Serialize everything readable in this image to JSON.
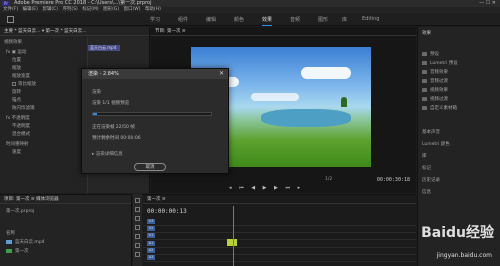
{
  "titlebar": {
    "app_badge": "Pr",
    "title": "Adobe Premiere Pro CC 2018 - C:\\Users\\...\\第一次.prproj",
    "controls": "—  ☐  ✕"
  },
  "menubar": [
    "文件(F)",
    "编辑(E)",
    "剪辑(C)",
    "序列(S)",
    "标记(M)",
    "图形(G)",
    "窗口(W)",
    "帮助(H)"
  ],
  "workspaces": [
    "学习",
    "组件",
    "编辑",
    "颜色",
    "效果",
    "音频",
    "图形",
    "库",
    "Editing"
  ],
  "active_workspace": "效果",
  "effect_controls": {
    "header": "主要 * 蓝天白云... ▾ 第一次 * 蓝天白云...",
    "clip_name": "蓝天白云.mp4",
    "rows": [
      {
        "label": "视频效果",
        "value": ""
      },
      {
        "label": "fx ▣ 运动",
        "value": ""
      },
      {
        "label": "位置",
        "value": ""
      },
      {
        "label": "缩放",
        "value": ""
      },
      {
        "label": "缩放宽度",
        "value": ""
      },
      {
        "label": "等比缩放",
        "value": ""
      },
      {
        "label": "旋转",
        "value": ""
      },
      {
        "label": "锚点",
        "value": ""
      },
      {
        "label": "防闪烁滤镜",
        "value": ""
      },
      {
        "label": "fx 不透明度",
        "value": ""
      },
      {
        "label": "不透明度",
        "value": ""
      },
      {
        "label": "混合模式",
        "value": ""
      },
      {
        "label": "时间重映射",
        "value": ""
      },
      {
        "label": "速度",
        "value": ""
      }
    ]
  },
  "monitor": {
    "header": "节目: 第一次 ≡",
    "timecode": "00:00:30:18",
    "zoom": "1/2",
    "controls": "◂ ⏮ ◀ ▶ ▶ ⏭ ▸"
  },
  "right_panel": {
    "title": "效果",
    "items": [
      "预设",
      "Lumetri 预设",
      "音频效果",
      "音频过渡",
      "视频效果",
      "视频过渡",
      "自定义素材箱"
    ],
    "lower": [
      "基本声音",
      "Lumetri 颜色",
      "库",
      "标记",
      "历史记录",
      "信息"
    ]
  },
  "project": {
    "header": "项目: 第一次 ≡  媒体浏览器",
    "file": "第一次.prproj",
    "column": "名称",
    "items": [
      {
        "name": "蓝天白云.mp4",
        "color": "#5d9fd0"
      },
      {
        "name": "第一次",
        "color": "#3aa14a"
      }
    ]
  },
  "timeline": {
    "header": "第一次 ≡",
    "timecode": "00:00:00:13",
    "tracks": [
      "V3",
      "V2",
      "V1",
      "A1",
      "A2",
      "A3"
    ]
  },
  "dialog": {
    "title": "渲染 - 2.84%",
    "close": "✕",
    "section": "渲染",
    "step": "渲染 1/1 视频预览",
    "progress": 0.0284,
    "rendering": "正在渲染帧 22/50 帧",
    "time_remaining": "预计剩余时间 00:00:06",
    "details": "渲染详细信息",
    "cancel": "取消"
  },
  "watermark": {
    "line1": "Baidu经验",
    "line2": "jingyan.baidu.com"
  }
}
